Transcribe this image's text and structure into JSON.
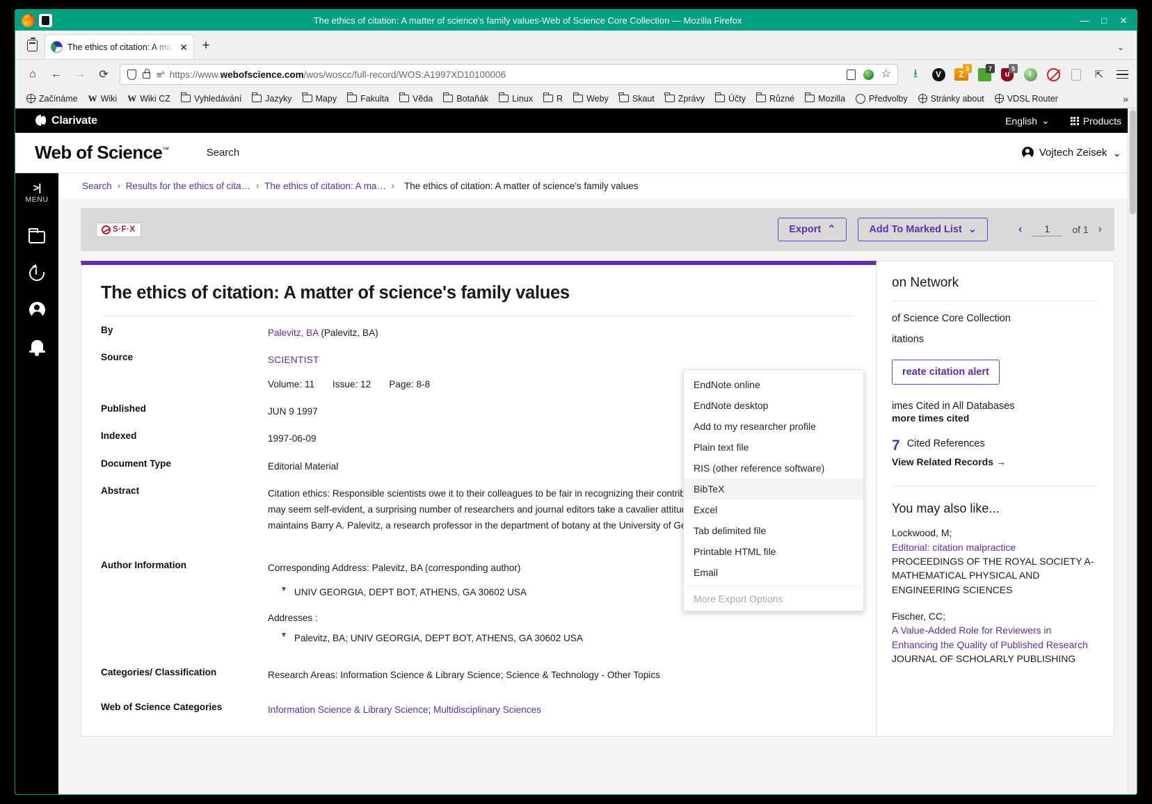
{
  "browser": {
    "window_title": "The ethics of citation: A matter of science's family values-Web of Science Core Collection — Mozilla Firefox",
    "window_buttons": {
      "minimize": "—",
      "maximize": "□",
      "close": "✕"
    },
    "tab": {
      "title": "The ethics of citation: A ma",
      "close": "✕"
    },
    "new_tab": "+",
    "tabs_overflow_chevron": "⌄",
    "url": "https://www.webofscience.com/wos/woscc/full-record/WOS:A1997XD10100006",
    "url_domain": "webofscience.com",
    "url_prefix": "https://www.",
    "url_suffix": "/wos/woscc/full-record/WOS:A1997XD10100006",
    "ext_badges": {
      "zotero": "3",
      "green": "7",
      "shield": "5"
    },
    "bookmarks": [
      {
        "label": "Začínáme",
        "icon": "globe-icon"
      },
      {
        "label": "Wiki",
        "icon": "wikipedia-icon"
      },
      {
        "label": "Wiki CZ",
        "icon": "wikipedia-icon"
      },
      {
        "label": "Vyhledávání",
        "icon": "folder-icon"
      },
      {
        "label": "Jazyky",
        "icon": "folder-icon"
      },
      {
        "label": "Mapy",
        "icon": "folder-icon"
      },
      {
        "label": "Fakulta",
        "icon": "folder-icon"
      },
      {
        "label": "Věda",
        "icon": "folder-icon"
      },
      {
        "label": "Botaňák",
        "icon": "folder-icon"
      },
      {
        "label": "Linux",
        "icon": "folder-icon"
      },
      {
        "label": "R",
        "icon": "folder-icon"
      },
      {
        "label": "Weby",
        "icon": "folder-icon"
      },
      {
        "label": "Skaut",
        "icon": "folder-icon"
      },
      {
        "label": "Zprávy",
        "icon": "folder-icon"
      },
      {
        "label": "Účty",
        "icon": "folder-icon"
      },
      {
        "label": "Různé",
        "icon": "folder-icon"
      },
      {
        "label": "Mozilla",
        "icon": "folder-icon"
      },
      {
        "label": "Předvolby",
        "icon": "gear-icon"
      },
      {
        "label": "Stránky about",
        "icon": "globe-icon"
      },
      {
        "label": "VDSL Router",
        "icon": "globe-icon"
      }
    ],
    "bookmarks_overflow": "»"
  },
  "clarivate": {
    "brand": "Clarivate",
    "language": "English",
    "language_chevron": "⌄",
    "products": "Products"
  },
  "wos": {
    "logo": "Web of Science",
    "trademark": "™",
    "nav_search": "Search",
    "user_name": "Vojtech Zeisek",
    "user_chevron": "⌄"
  },
  "sidebar": {
    "menu_arrow": ">|",
    "menu_label": "MENU",
    "items": [
      {
        "name": "folder-icon"
      },
      {
        "name": "history-icon"
      },
      {
        "name": "profile-icon"
      },
      {
        "name": "bell-icon"
      }
    ]
  },
  "breadcrumb": {
    "items": [
      "Search",
      "Results for the ethics of cita…",
      "The ethics of citation: A ma…"
    ],
    "separator": "›",
    "current": "The ethics of citation: A matter of science's family values"
  },
  "actionbar": {
    "sfx_label": "S·F·X",
    "export_label": "Export",
    "export_chevron": "⌃",
    "marked_list_label": "Add To Marked List",
    "marked_list_chevron": "⌄",
    "pager": {
      "prev": "‹",
      "next": "›",
      "current": "1",
      "of_label": "of 1"
    }
  },
  "export_menu": {
    "items": [
      {
        "label": "EndNote online",
        "state": "normal"
      },
      {
        "label": "EndNote desktop",
        "state": "normal"
      },
      {
        "label": "Add to my researcher profile",
        "state": "normal"
      },
      {
        "label": "Plain text file",
        "state": "normal"
      },
      {
        "label": "RIS (other reference software)",
        "state": "normal"
      },
      {
        "label": "BibTeX",
        "state": "hover"
      },
      {
        "label": "Excel",
        "state": "normal"
      },
      {
        "label": "Tab delimited file",
        "state": "normal"
      },
      {
        "label": "Printable HTML file",
        "state": "normal"
      },
      {
        "label": "Email",
        "state": "normal"
      },
      {
        "label": "More Export Options",
        "state": "disabled"
      }
    ]
  },
  "record": {
    "title": "The ethics of citation: A matter of science's family values",
    "fields": {
      "by_label": "By",
      "by_link": "Palevitz, BA",
      "by_extra": "(Palevitz, BA)",
      "source_label": "Source",
      "source_link": "SCIENTIST",
      "volume": "Volume: 11",
      "issue": "Issue: 12",
      "page": "Page: 8-8",
      "published_label": "Published",
      "published_value": "JUN 9 1997",
      "indexed_label": "Indexed",
      "indexed_value": "1997-06-09",
      "doctype_label": "Document Type",
      "doctype_value": "Editorial Material",
      "abstract_label": "Abstract",
      "abstract_value": "Citation ethics: Responsible scientists owe it to their colleagues to be fair in recognizing their contributions by citing prior work; while this may seem self-evident, a surprising number of researchers and journal editors take a cavalier attitude toward such a basic ''family value,'' maintains Barry A. Palevitz, a research professor in the department of botany at the University of Georgia.",
      "author_info_label": "Author Information",
      "corresponding_address": "Corresponding Address: Palevitz, BA  (corresponding author)",
      "corresponding_affiliation": "UNIV GEORGIA, DEPT BOT, ATHENS, GA 30602 USA",
      "addresses_label": "Addresses :",
      "address_entry": "Palevitz, BA;   UNIV GEORGIA, DEPT BOT, ATHENS, GA 30602 USA",
      "categories_label": "Categories/ Classification",
      "categories_value": "Research Areas: Information Science & Library Science; Science & Technology - Other Topics",
      "wos_categories_label": "Web of Science Categories",
      "wos_categories_link1": "Information Science & Library Science",
      "wos_categories_sep": ";",
      "wos_categories_link2": "Multidisciplinary Sciences"
    }
  },
  "right_panel": {
    "title_visible": "on Network",
    "core_collection_text": "of Science Core Collection",
    "citations_text": "itations",
    "alert_button": "reate citation alert",
    "times_cited_all_db": "imes Cited in All Databases",
    "more_times_cited": "more times cited",
    "cited_refs_count": "7",
    "cited_refs_label": "Cited References",
    "view_related": "View Related Records →",
    "you_may_also_like": "You may also like...",
    "items": [
      {
        "authors": "Lockwood, M;",
        "title": "Editorial: citation malpractice",
        "journal": "PROCEEDINGS OF THE ROYAL SOCIETY A-MATHEMATICAL PHYSICAL AND ENGINEERING SCIENCES"
      },
      {
        "authors": "Fischer, CC;",
        "title": "A Value-Added Role for Reviewers in Enhancing the Quality of Published Research",
        "journal": "JOURNAL OF SCHOLARLY PUBLISHING"
      }
    ]
  }
}
